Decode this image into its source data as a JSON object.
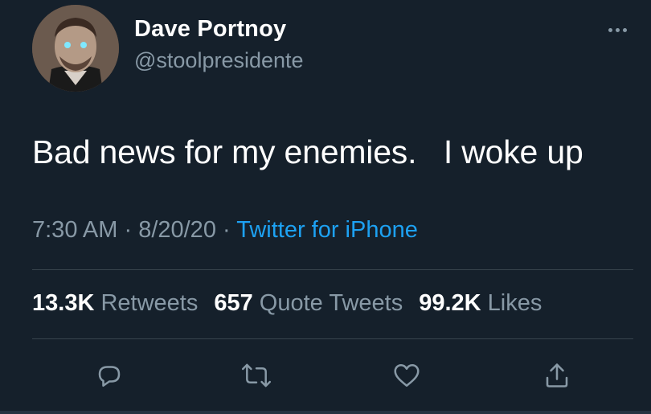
{
  "user": {
    "name": "Dave Portnoy",
    "handle": "@stoolpresidente"
  },
  "tweet": {
    "text": "Bad news for my enemies.   I woke up",
    "time": "7:30 AM",
    "separator1": " · ",
    "date": "8/20/20",
    "separator2": " · ",
    "source": "Twitter for iPhone"
  },
  "stats": {
    "retweets": {
      "count": "13.3K",
      "label": "Retweets"
    },
    "quotes": {
      "count": "657",
      "label": "Quote Tweets"
    },
    "likes": {
      "count": "99.2K",
      "label": "Likes"
    }
  },
  "actions": [
    "reply-icon",
    "retweet-icon",
    "like-icon",
    "share-icon"
  ],
  "colors": {
    "background": "#15202b",
    "secondary_text": "#8899a6",
    "link": "#1da1f2",
    "divider": "#38444d"
  }
}
